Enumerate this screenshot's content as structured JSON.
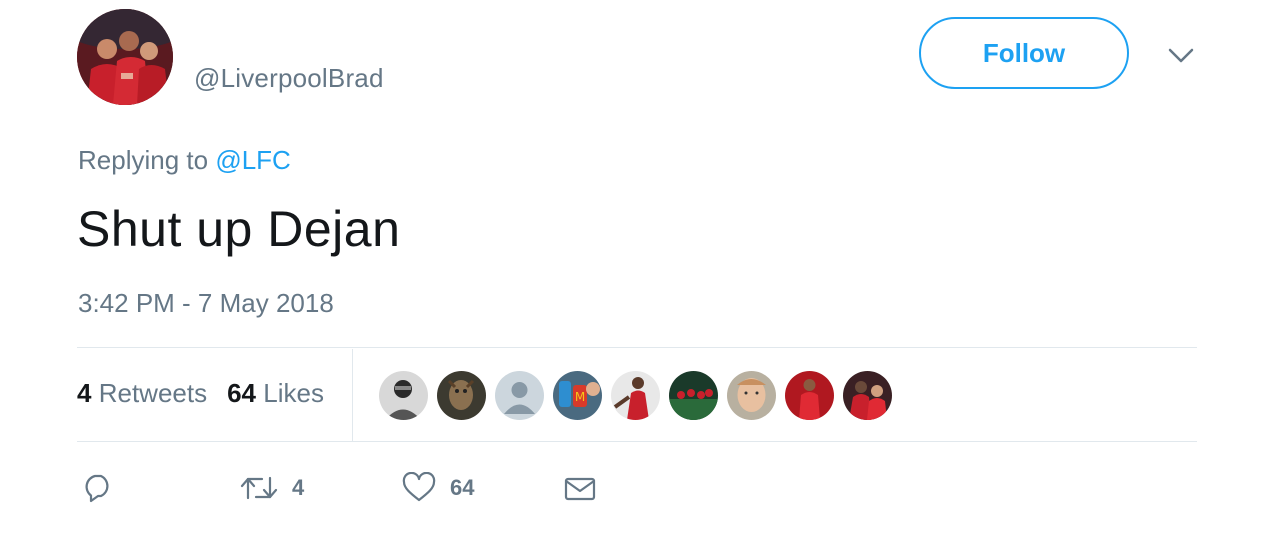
{
  "user": {
    "handle": "@LiverpoolBrad",
    "avatar_icon": "profile-photo"
  },
  "header": {
    "follow_label": "Follow",
    "menu_icon": "chevron-down-icon"
  },
  "tweet": {
    "replying_prefix": "Replying to ",
    "replying_to": "@LFC",
    "text": "Shut up Dejan",
    "timestamp": "3:42 PM - 7 May 2018"
  },
  "stats": {
    "retweets_count": "4",
    "retweets_label": "Retweets",
    "likes_count": "64",
    "likes_label": "Likes"
  },
  "actions": {
    "reply_icon": "reply-icon",
    "retweet_icon": "retweet-icon",
    "retweet_count": "4",
    "like_icon": "heart-icon",
    "like_count": "64",
    "dm_icon": "envelope-icon"
  },
  "colors": {
    "accent": "#1da1f2",
    "secondary_text": "#657786",
    "primary_text": "#14171a",
    "divider": "#e1e8ed"
  }
}
